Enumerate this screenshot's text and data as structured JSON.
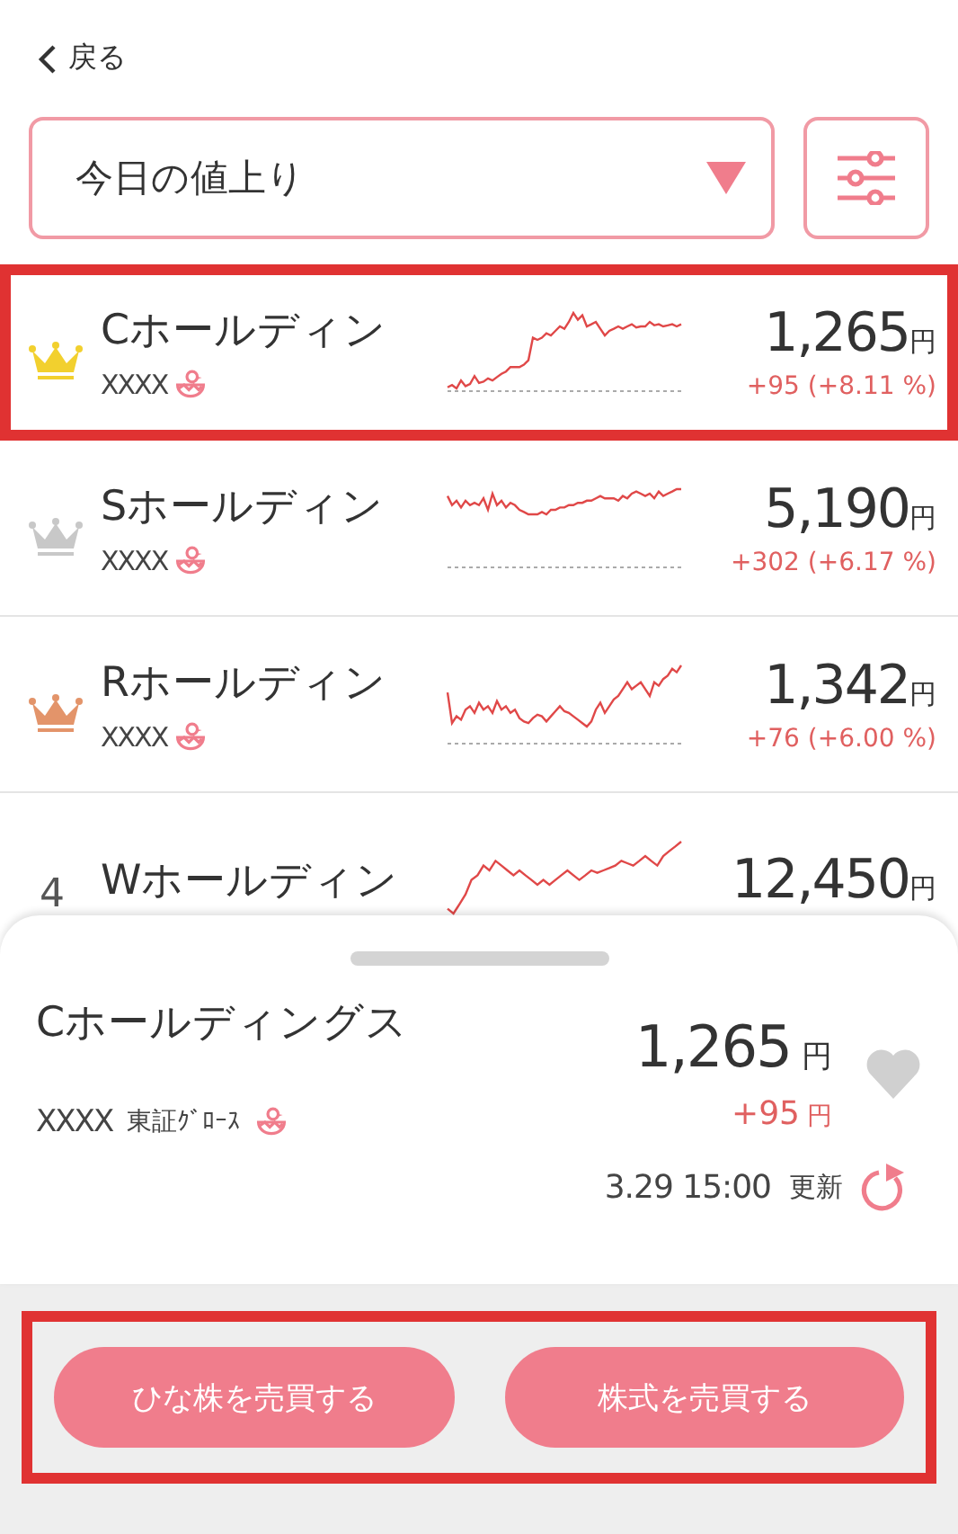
{
  "back": {
    "label": "戻る"
  },
  "filter": {
    "value": "今日の値上り"
  },
  "rows": [
    {
      "kind": "crown",
      "color": "#f2d02e",
      "highlighted": true,
      "name": "Cホールディン",
      "code": "XXXX",
      "price": "1,265",
      "unit": "円",
      "change": "+95 (+8.11 %)"
    },
    {
      "kind": "crown",
      "color": "#c8c8c8",
      "highlighted": false,
      "name": "Sホールディン",
      "code": "XXXX",
      "price": "5,190",
      "unit": "円",
      "change": "+302 (+6.17 %)"
    },
    {
      "kind": "crown",
      "color": "#e3946a",
      "highlighted": false,
      "name": "Rホールディン",
      "code": "XXXX",
      "price": "1,342",
      "unit": "円",
      "change": "+76 (+6.00 %)"
    },
    {
      "kind": "number",
      "rank": "4",
      "highlighted": false,
      "name": "Wホールディン",
      "price": "12,450",
      "unit": "円"
    }
  ],
  "sheet": {
    "name": "Cホールディングス",
    "code": "XXXX",
    "market": "東証ｸﾞﾛｰｽ",
    "price": "1,265",
    "unit": "円",
    "change": "+95",
    "change_unit": "円",
    "favorite": false,
    "updated": "3.29 15:00",
    "updated_label": "更新"
  },
  "actions": {
    "highlighted": true,
    "buttons": [
      "ひな株を売買する",
      "株式を売買する"
    ]
  }
}
